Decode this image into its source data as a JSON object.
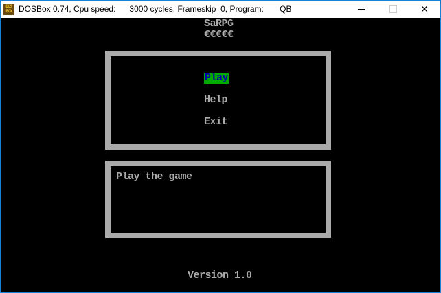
{
  "window": {
    "title": "DOSBox 0.74, Cpu speed:      3000 cycles, Frameskip  0, Program:       QB",
    "icon_text": "DOS BOX",
    "minimize_icon": "minimize-icon",
    "maximize_icon": "maximize-icon",
    "close_icon": "close-icon"
  },
  "game": {
    "title": "SaRPG",
    "title_underline": "€€€€€",
    "menu": [
      {
        "label": "Play",
        "selected": true
      },
      {
        "label": "Help",
        "selected": false
      },
      {
        "label": "Exit",
        "selected": false
      }
    ],
    "description": "Play the game",
    "version": "Version 1.0"
  },
  "colors": {
    "selected_bg": "#00aa00",
    "selected_fg": "#0000aa",
    "text": "#aaaaaa",
    "border": "#aaaaaa"
  }
}
